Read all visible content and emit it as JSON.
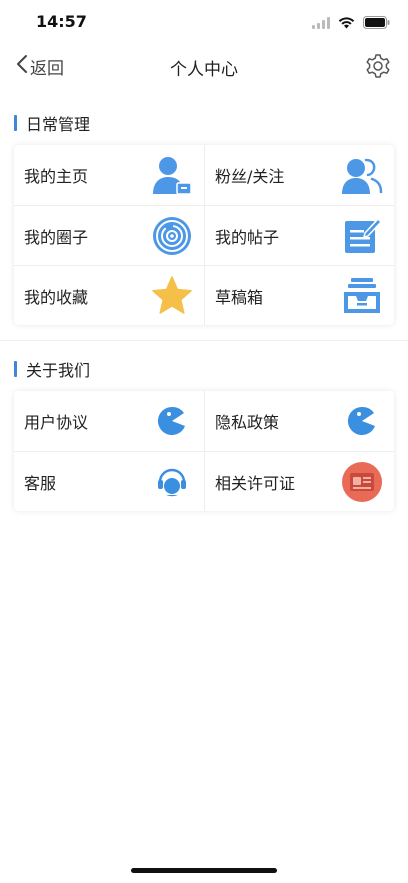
{
  "status_bar": {
    "time": "14:57"
  },
  "nav": {
    "back_label": "返回",
    "title": "个人中心"
  },
  "sections": [
    {
      "title": "日常管理",
      "items": [
        {
          "label": "我的主页",
          "icon": "user-profile-icon"
        },
        {
          "label": "粉丝/关注",
          "icon": "users-icon"
        },
        {
          "label": "我的圈子",
          "icon": "circles-icon"
        },
        {
          "label": "我的帖子",
          "icon": "post-edit-icon"
        },
        {
          "label": "我的收藏",
          "icon": "star-icon"
        },
        {
          "label": "草稿箱",
          "icon": "inbox-tray-icon"
        }
      ]
    },
    {
      "title": "关于我们",
      "items": [
        {
          "label": "用户协议",
          "icon": "app-logo-icon"
        },
        {
          "label": "隐私政策",
          "icon": "app-logo-icon"
        },
        {
          "label": "客服",
          "icon": "customer-service-icon"
        },
        {
          "label": "相关许可证",
          "icon": "license-card-icon"
        }
      ]
    }
  ],
  "colors": {
    "accent": "#3d87d8",
    "icon_blue": "#4d98e6",
    "star": "#f5c04a",
    "license_red": "#e86a57"
  }
}
